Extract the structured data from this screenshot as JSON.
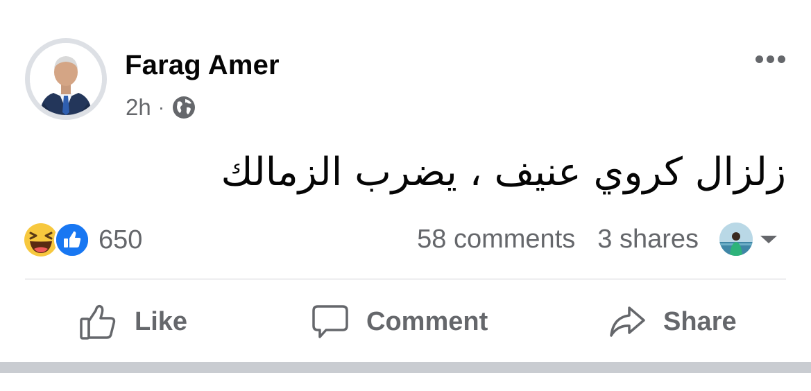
{
  "post": {
    "author": "Farag Amer",
    "time": "2h",
    "separator": "·",
    "privacy_icon": "globe-icon",
    "more_icon": "more-horizontal-icon",
    "text": "زلزال كروي عنيف ، يضرب الزمالك"
  },
  "engagement": {
    "reaction_icons": [
      "haha-reaction-icon",
      "like-reaction-icon"
    ],
    "reaction_count": "650",
    "comments": "58 comments",
    "shares": "3 shares"
  },
  "actions": {
    "like": "Like",
    "comment": "Comment",
    "share": "Share"
  },
  "colors": {
    "text_primary": "#050505",
    "text_secondary": "#65676b",
    "like_blue": "#1877f2",
    "haha_yellow": "#f7c83e",
    "divider": "#ced0d4"
  }
}
